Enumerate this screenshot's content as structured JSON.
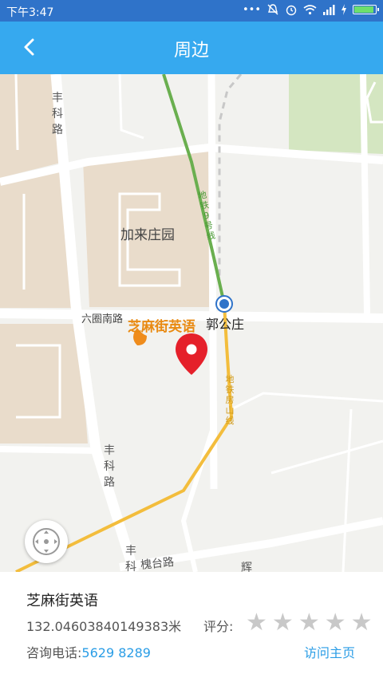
{
  "status_bar": {
    "time": "下午3:47",
    "icons": [
      "more-dots-icon",
      "mute-icon",
      "alarm-icon",
      "wifi-icon",
      "signal-icon",
      "charging-icon",
      "battery-icon"
    ],
    "more_dots": "•••",
    "battery_level": 0.95
  },
  "app_bar": {
    "title": "周边",
    "back_icon": "chevron-left-icon"
  },
  "map": {
    "labels": {
      "fengke_road_north": "丰科路",
      "jialai_garden": "加来庄园",
      "subway_line9": "地铁9号线",
      "liuquan_road": "六圈南路",
      "station": "郭公庄",
      "subway_fangshan": "地铁房山线",
      "fengke_road_south": "丰科路",
      "fengke_road_bottom": "丰科",
      "huaitai_road": "槐台路",
      "bottom_cut": "辉"
    },
    "poi": {
      "name": "芝麻街英语",
      "pin_color": "#e5202a",
      "icon": "map-pin-icon"
    },
    "colors": {
      "line9": "#6aaf4f",
      "fangshan_line": "#f3bd3c",
      "residential": "#e9dccb",
      "park": "#d4e6c1"
    },
    "locate_icon": "locate-crosshair-icon"
  },
  "info": {
    "name": "芝麻街英语",
    "distance": "132.04603840149383米",
    "rating_label": "评分:",
    "rating": 0,
    "rating_max": 5,
    "phone_label": "咨询电话:",
    "phone": "5629 8289",
    "visit_label": "访问主页"
  }
}
